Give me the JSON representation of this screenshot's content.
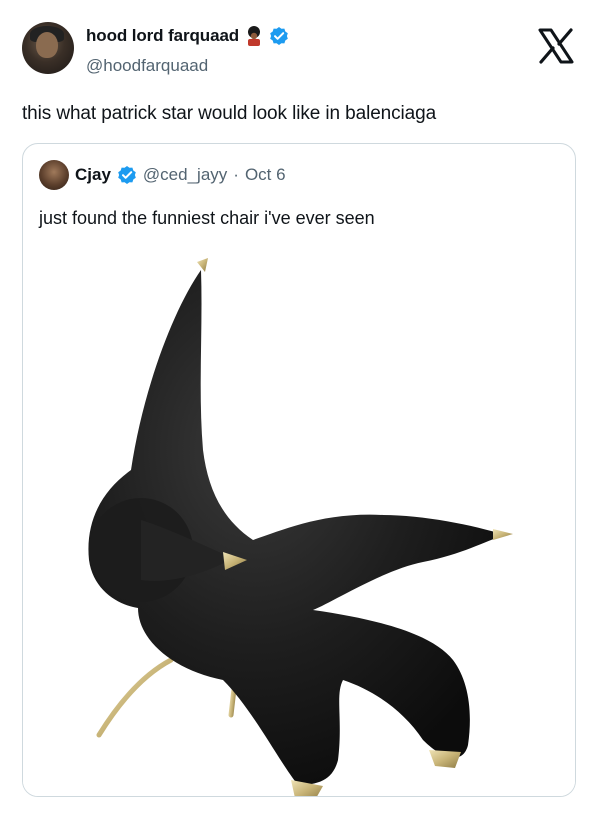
{
  "author": {
    "display_name": "hood lord farquaad",
    "handle": "@hoodfarquaad",
    "verified": true,
    "name_emoji": "guard-emoji"
  },
  "tweet": {
    "text": "this what patrick star would look like in balenciaga"
  },
  "quoted": {
    "display_name": "Cjay",
    "handle": "@ced_jayy",
    "separator": "·",
    "date": "Oct 6",
    "text": "just found the funniest chair i've ever seen",
    "image": "starfish-chair-image"
  },
  "logo": "x-logo-icon",
  "colors": {
    "verified": "#1d9bf0",
    "secondary_text": "#536471",
    "border": "#cfd9de"
  }
}
